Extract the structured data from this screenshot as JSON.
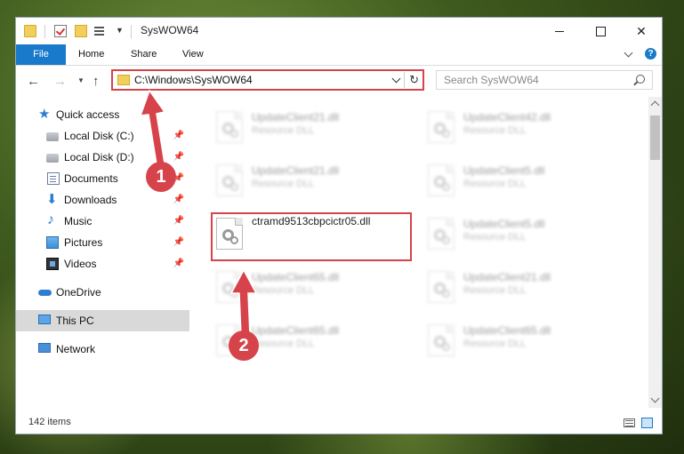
{
  "window": {
    "title": "SysWOW64"
  },
  "ribbon": {
    "tabs": [
      "File",
      "Home",
      "Share",
      "View"
    ]
  },
  "nav": {
    "address": "C:\\Windows\\SysWOW64",
    "search_placeholder": "Search SysWOW64"
  },
  "sidebar": {
    "items": [
      {
        "label": "Quick access",
        "icon": "star-icon"
      },
      {
        "label": "Local Disk (C:)",
        "icon": "disk-icon",
        "pinned": true
      },
      {
        "label": "Local Disk (D:)",
        "icon": "disk-icon",
        "pinned": true
      },
      {
        "label": "Documents",
        "icon": "document-icon",
        "pinned": true
      },
      {
        "label": "Downloads",
        "icon": "download-icon",
        "pinned": true
      },
      {
        "label": "Music",
        "icon": "music-icon",
        "pinned": true
      },
      {
        "label": "Pictures",
        "icon": "pictures-icon",
        "pinned": true
      },
      {
        "label": "Videos",
        "icon": "videos-icon",
        "pinned": true
      },
      {
        "label": "OneDrive",
        "icon": "cloud-icon"
      },
      {
        "label": "This PC",
        "icon": "computer-icon",
        "selected": true
      },
      {
        "label": "Network",
        "icon": "network-icon"
      }
    ]
  },
  "files": {
    "left": [
      {
        "name": "UpdateClient21.dll",
        "type": "Resource DLL"
      },
      {
        "name": "UpdateClient21.dll",
        "type": "Resource DLL"
      },
      {
        "name": "ctramd9513cbpcictr05.dll",
        "type": ""
      },
      {
        "name": "UpdateClient65.dll",
        "type": "Resource DLL"
      },
      {
        "name": "UpdateClient65.dll",
        "type": "Resource DLL"
      }
    ],
    "right": [
      {
        "name": "UpdateClient42.dll",
        "type": "Resource DLL"
      },
      {
        "name": "UpdateClient5.dll",
        "type": "Resource DLL"
      },
      {
        "name": "UpdateClient5.dll",
        "type": "Resource DLL"
      },
      {
        "name": "UpdateClient21.dll",
        "type": "Resource DLL"
      },
      {
        "name": "UpdateClient65.dll",
        "type": "Resource DLL"
      }
    ]
  },
  "status": {
    "count": "142 items"
  },
  "annotations": {
    "step1": "1",
    "step2": "2",
    "color": "#d6434a"
  }
}
